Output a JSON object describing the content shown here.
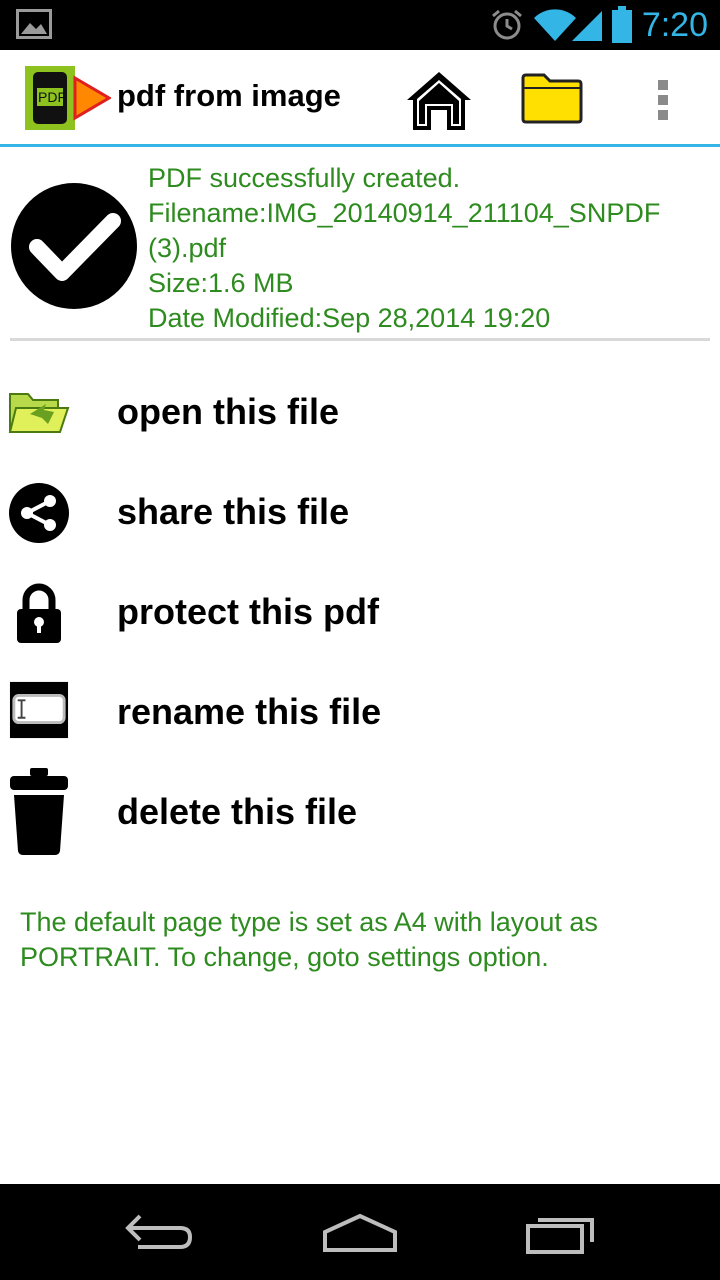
{
  "status_bar": {
    "time": "7:20"
  },
  "action_bar": {
    "title": "pdf from image",
    "logo_text": "PDF"
  },
  "result": {
    "line1": "PDF successfully created.",
    "line2": "Filename:IMG_20140914_211104_SNPDF",
    "line3": "(3).pdf",
    "line4": "Size:1.6 MB",
    "line5": "Date Modified:Sep 28,2014 19:20"
  },
  "menu": {
    "items": [
      {
        "label": "open this file",
        "icon": "open-folder-icon"
      },
      {
        "label": "share this file",
        "icon": "share-icon"
      },
      {
        "label": "protect this pdf",
        "icon": "lock-icon"
      },
      {
        "label": "rename this file",
        "icon": "rename-icon"
      },
      {
        "label": "delete this file",
        "icon": "trash-icon"
      }
    ]
  },
  "note": "The default page type is set as A4 with layout as PORTRAIT. To change, goto settings option.",
  "colors": {
    "accent": "#33b5e5",
    "success_text": "#2e8b1f"
  }
}
